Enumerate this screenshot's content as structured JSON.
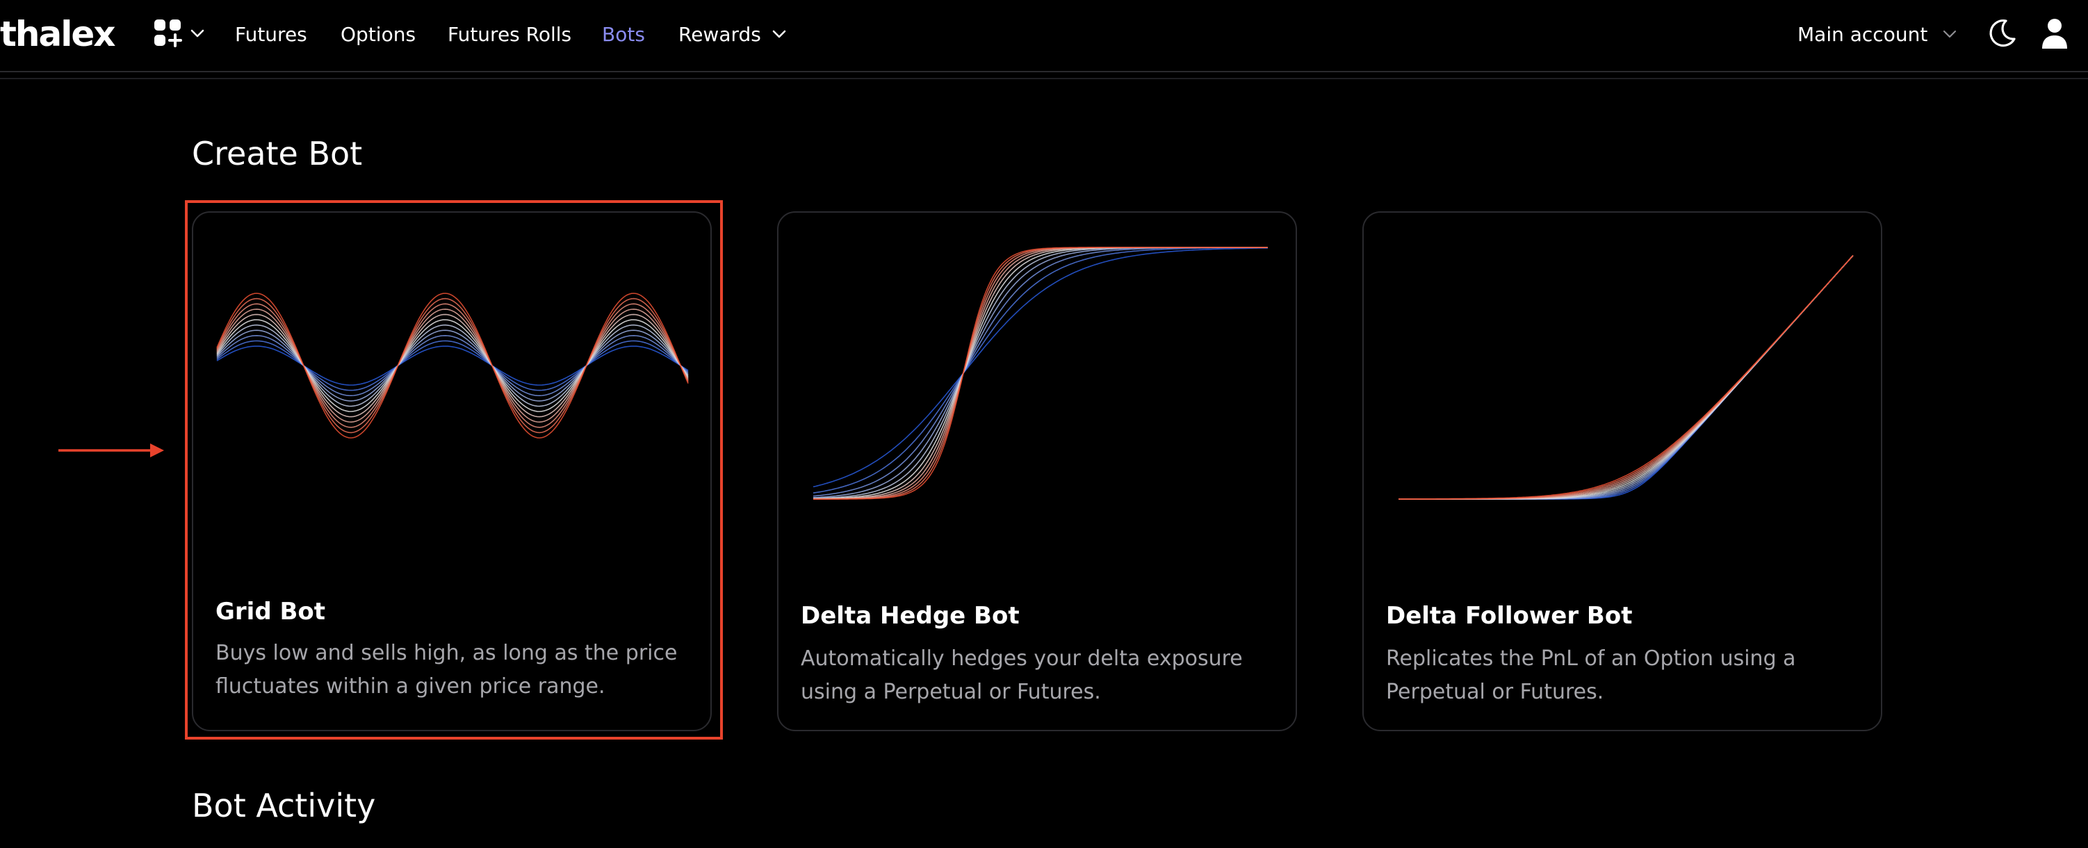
{
  "header": {
    "logo": "thalex",
    "nav": [
      {
        "label": "Futures",
        "active": false
      },
      {
        "label": "Options",
        "active": false
      },
      {
        "label": "Futures Rolls",
        "active": false
      },
      {
        "label": "Bots",
        "active": true
      },
      {
        "label": "Rewards",
        "active": false
      }
    ],
    "account_label": "Main account",
    "icons": [
      "apps-icon",
      "chevron-down-icon",
      "moon-icon",
      "user-icon"
    ]
  },
  "create_section": {
    "title": "Create Bot",
    "cards": [
      {
        "title": "Grid Bot",
        "description": "Buys low and sells high, as long as the price fluctuates within a given price range.",
        "art": "sine-wave-bundle"
      },
      {
        "title": "Delta Hedge Bot",
        "description": "Automatically hedges your delta exposure using a Perpetual or Futures.",
        "art": "s-curve-bundle"
      },
      {
        "title": "Delta Follower Bot",
        "description": "Replicates the PnL of an Option using a Perpetual or Futures.",
        "art": "hockey-stick-bundle"
      }
    ]
  },
  "activity_section": {
    "title": "Bot Activity"
  },
  "colors": {
    "background": "#000000",
    "active_nav": "#8a8cf0",
    "highlight": "#e8432c",
    "card_border": "#2a2a2e",
    "muted_text": "#a6a6ab"
  }
}
